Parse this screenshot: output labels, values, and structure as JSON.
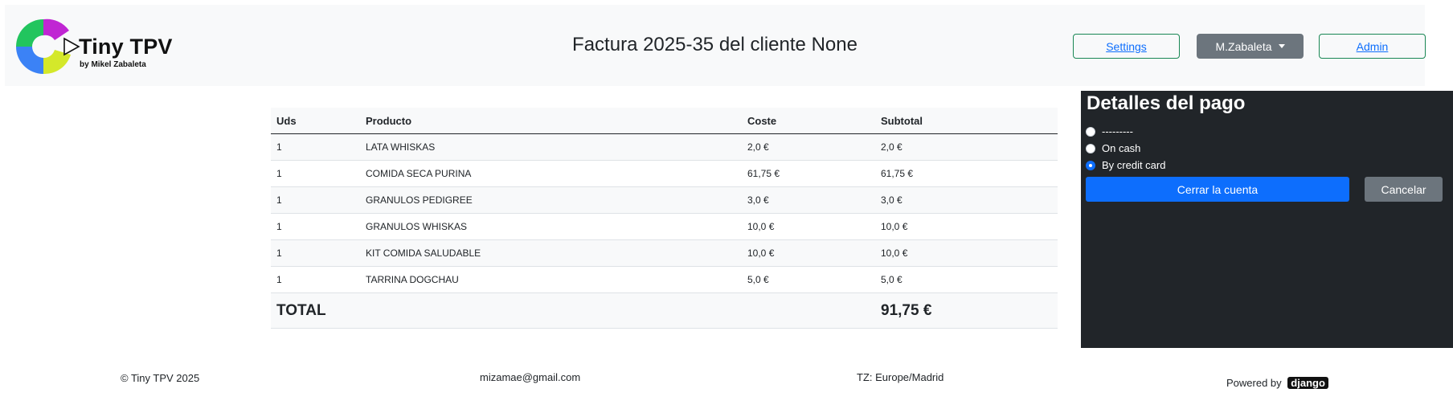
{
  "header": {
    "app_name": "Tiny TPV",
    "app_byline": "by Mikel Zabaleta",
    "page_title": "Factura 2025-35 del cliente None",
    "settings_label": "Settings",
    "user_label": "M.Zabaleta",
    "admin_label": "Admin"
  },
  "invoice": {
    "columns": [
      "Uds",
      "Producto",
      "Coste",
      "Subtotal"
    ],
    "rows": [
      {
        "uds": "1",
        "producto": "LATA WHISKAS",
        "coste": "2,0 €",
        "subtotal": "2,0 €"
      },
      {
        "uds": "1",
        "producto": "COMIDA SECA PURINA",
        "coste": "61,75 €",
        "subtotal": "61,75 €"
      },
      {
        "uds": "1",
        "producto": "GRANULOS PEDIGREE",
        "coste": "3,0 €",
        "subtotal": "3,0 €"
      },
      {
        "uds": "1",
        "producto": "GRANULOS WHISKAS",
        "coste": "10,0 €",
        "subtotal": "10,0 €"
      },
      {
        "uds": "1",
        "producto": "KIT COMIDA SALUDABLE",
        "coste": "10,0 €",
        "subtotal": "10,0 €"
      },
      {
        "uds": "1",
        "producto": "TARRINA DOGCHAU",
        "coste": "5,0 €",
        "subtotal": "5,0 €"
      }
    ],
    "total_label": "TOTAL",
    "total_value": "91,75 €"
  },
  "payment": {
    "title": "Detalles del pago",
    "options": [
      {
        "label": "---------",
        "checked": false
      },
      {
        "label": "On cash",
        "checked": false
      },
      {
        "label": "By credit card",
        "checked": true
      }
    ],
    "close_label": "Cerrar la cuenta",
    "cancel_label": "Cancelar"
  },
  "footer": {
    "copyright": "© Tiny TPV 2025",
    "email": "mizamae@gmail.com",
    "timezone": "TZ: Europe/Madrid",
    "powered_by": "Powered by",
    "powered_logo": "django"
  },
  "colors": {
    "primary": "#0d6efd",
    "secondary": "#6c757d",
    "success": "#198754",
    "dark": "#212529",
    "light": "#f8f9fa"
  }
}
